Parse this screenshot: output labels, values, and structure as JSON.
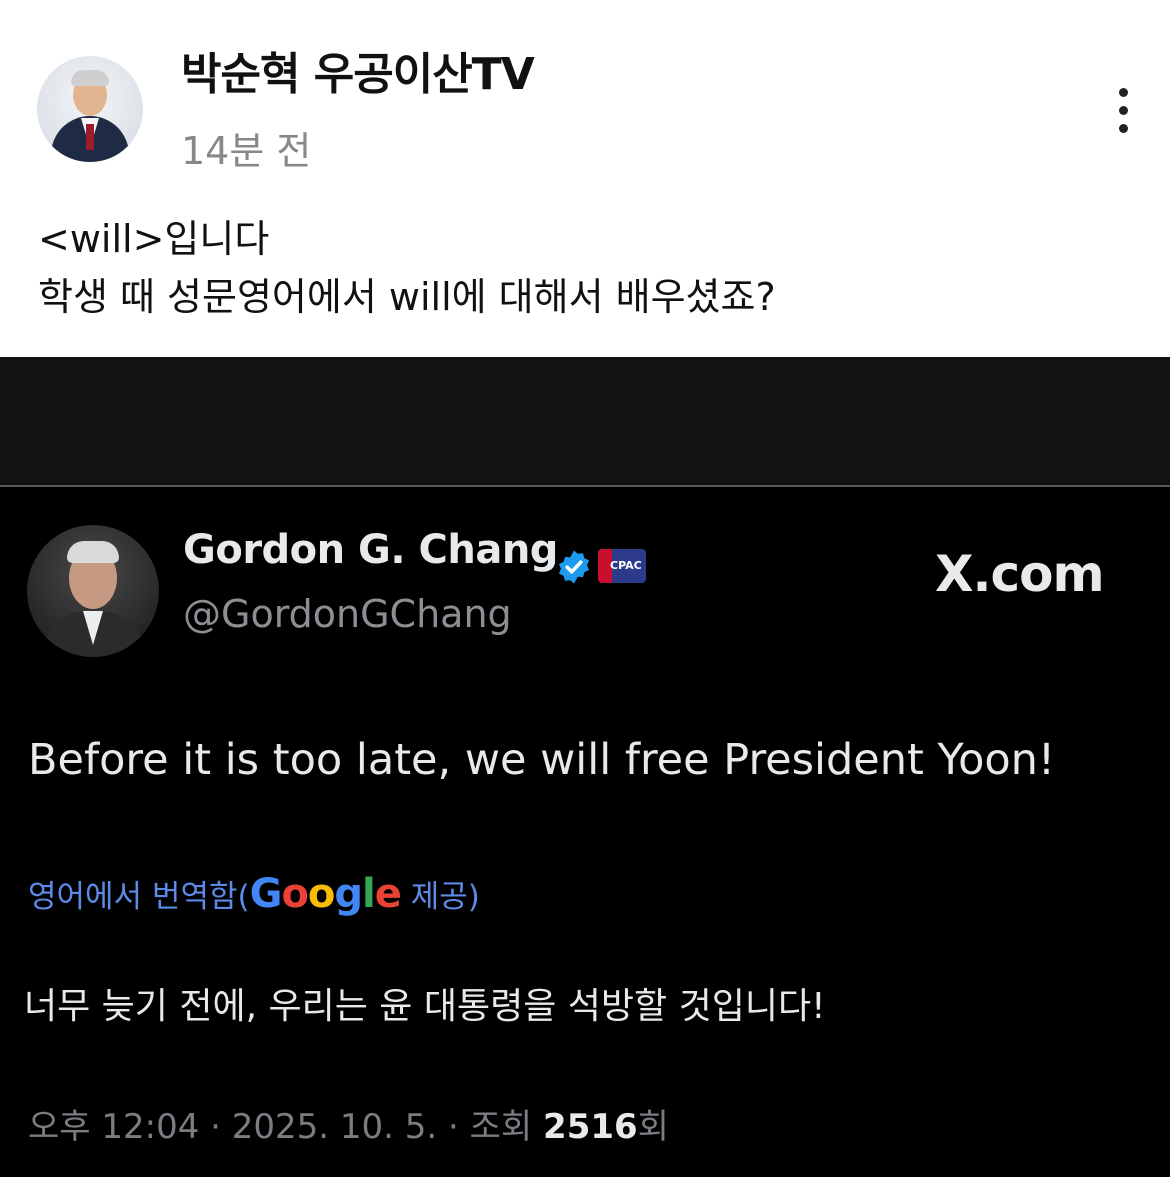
{
  "post": {
    "channel_name": "박순혁 우공이산TV",
    "time_ago": "14분 전",
    "lines": [
      "<will>입니다",
      "학생 때 성문영어에서 will에 대해서 배우셨죠?"
    ]
  },
  "tweet": {
    "author_name": "Gordon G. Chang",
    "handle": "@GordonGChang",
    "source_label": "X.com",
    "text": "Before it is too late, we will free President Yoon!",
    "translated_prefix": "영어에서 번역함(",
    "google_letters": [
      "G",
      "o",
      "o",
      "g",
      "l",
      "e"
    ],
    "translated_suffix": " 제공)",
    "translation": "너무 늦기 전에, 우리는 윤 대통령을 석방할 것입니다!",
    "meta_prefix": "오후 12:04 · 2025. 10. 5. · 조회 ",
    "views": "2516",
    "views_suffix": "회",
    "badge_text": "CPAC"
  },
  "icons": [
    "more-options-icon",
    "verified-badge-icon",
    "cpac-badge-icon"
  ],
  "colors": {
    "verified_blue": "#1d9bf0",
    "translation_link": "#5c8ae6",
    "tweet_background": "#000000"
  }
}
